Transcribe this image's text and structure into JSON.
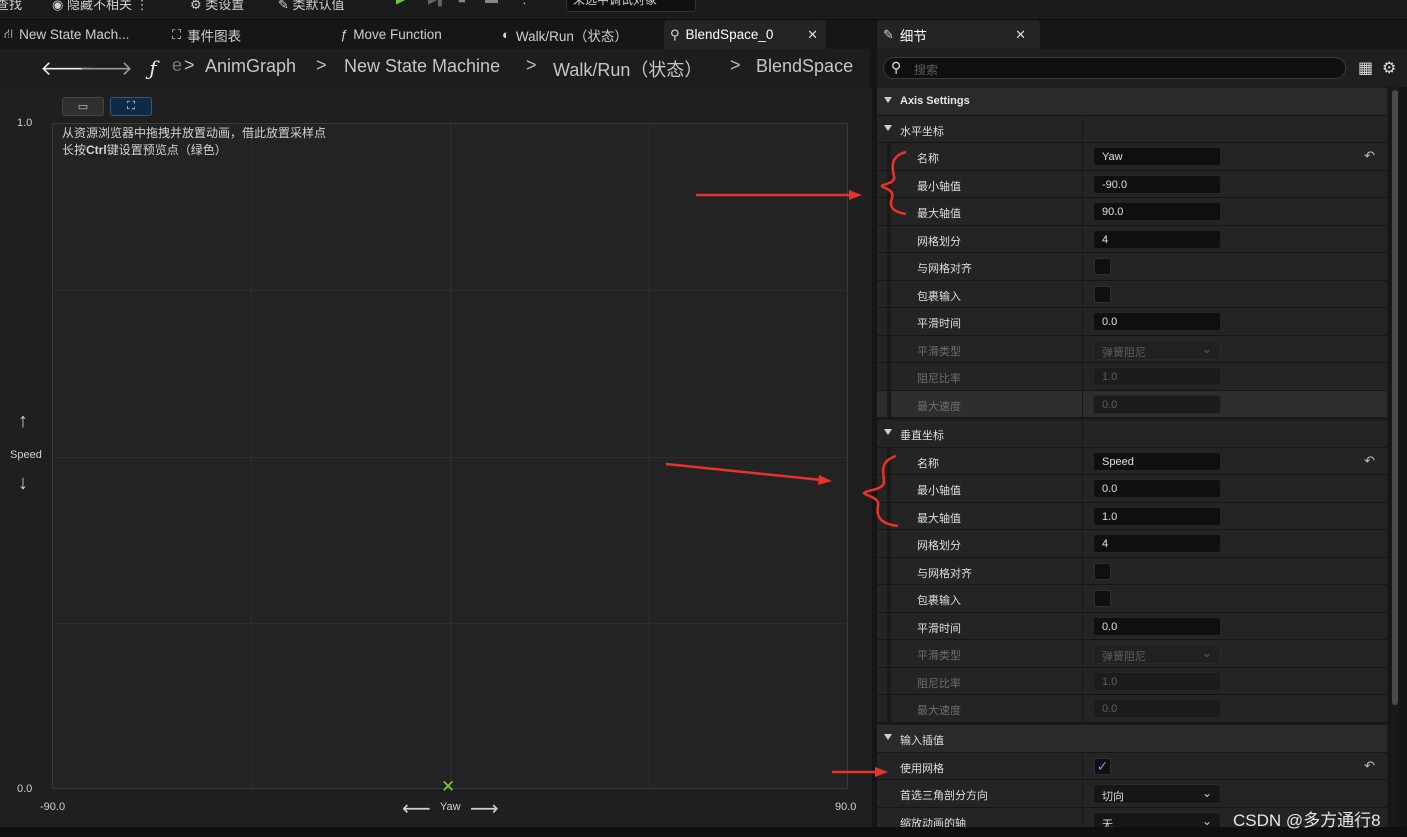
{
  "toolbar": {
    "items": [
      "查找",
      "隐藏不相关",
      "类设置",
      "类默认值",
      "未选中调试对象"
    ]
  },
  "tabs": [
    {
      "label": "New State Mach...",
      "icon": "state-machine-icon"
    },
    {
      "label": "事件图表",
      "icon": "event-graph-icon"
    },
    {
      "label": "Move Function",
      "icon": "function-icon"
    },
    {
      "label": "Walk/Run（状态）",
      "icon": "state-icon"
    },
    {
      "label": "BlendSpace_0",
      "icon": "blendspace-icon",
      "active": true
    }
  ],
  "details_tab": {
    "label": "细节",
    "icon": "pencil-icon"
  },
  "breadcrumbs": [
    "AnimGraph",
    "New State Machine",
    "Walk/Run（状态）",
    "BlendSpace"
  ],
  "graph": {
    "hint_line1": "从资源浏览器中拖拽并放置动画，借此放置采样点",
    "hint_line2_prefix": "长按",
    "hint_line2_key": "Ctrl",
    "hint_line2_suffix": "键设置预览点（绿色）",
    "y_max": "1.0",
    "y_min": "0.0",
    "x_min": "-90.0",
    "x_max": "90.0",
    "y_axis_name": "Speed",
    "x_axis_name": "Yaw"
  },
  "search": {
    "placeholder": "搜索"
  },
  "details": {
    "axis_settings": "Axis Settings",
    "horizontal": {
      "title": "水平坐标",
      "name_label": "名称",
      "name_value": "Yaw",
      "min_label": "最小轴值",
      "min_value": "-90.0",
      "max_label": "最大轴值",
      "max_value": "90.0",
      "grid_label": "网格划分",
      "grid_value": "4",
      "snap_label": "与网格对齐",
      "wrap_label": "包裹输入",
      "smooth_time_label": "平滑时间",
      "smooth_time_value": "0.0",
      "smooth_type_label": "平滑类型",
      "smooth_type_value": "弹簧阻尼",
      "damping_label": "阻尼比率",
      "damping_value": "1.0",
      "max_speed_label": "最大速度",
      "max_speed_value": "0.0"
    },
    "vertical": {
      "title": "垂直坐标",
      "name_label": "名称",
      "name_value": "Speed",
      "min_label": "最小轴值",
      "min_value": "0.0",
      "max_label": "最大轴值",
      "max_value": "1.0",
      "grid_label": "网格划分",
      "grid_value": "4",
      "snap_label": "与网格对齐",
      "wrap_label": "包裹输入",
      "smooth_time_label": "平滑时间",
      "smooth_time_value": "0.0",
      "smooth_type_label": "平滑类型",
      "smooth_type_value": "弹簧阻尼",
      "damping_label": "阻尼比率",
      "damping_value": "1.0",
      "max_speed_label": "最大速度",
      "max_speed_value": "0.0"
    },
    "input_interp": {
      "title": "输入插值",
      "use_grid_label": "使用网格",
      "use_grid_checked": true,
      "triangulation_label": "首选三角剖分方向",
      "triangulation_value": "切向",
      "scale_axis_label": "缩放动画的轴",
      "scale_axis_value": "无"
    }
  },
  "watermark": "CSDN @多方通行8",
  "colors": {
    "accent_red": "#e8332a",
    "check_blue": "#4aa3ff",
    "preview_green": "#7ec93a"
  }
}
